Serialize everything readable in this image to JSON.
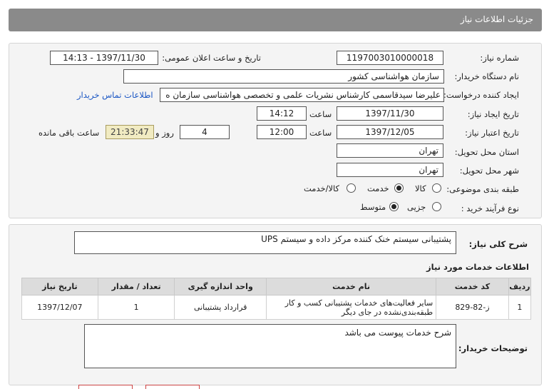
{
  "header": {
    "title": "جزئیات اطلاعات نیاز"
  },
  "fields": {
    "need_number_label": "شماره نیاز:",
    "need_number": "1197003010000018",
    "announce_label": "تاریخ و ساعت اعلان عمومی:",
    "announce_value": "1397/11/30 - 14:13",
    "buyer_label": "نام دستگاه خریدار:",
    "buyer_value": "سازمان هواشناسی کشور",
    "requester_label": "ایجاد کننده درخواست:",
    "requester_value": "علیرضا سیدقاسمی کارشناس نشریات علمی و تخصصی هواشناسی سازمان ه",
    "contact_link": "اطلاعات تماس خریدار",
    "created_label": "تاریخ ایجاد نیاز:",
    "created_date": "1397/11/30",
    "time_label": "ساعت",
    "created_time": "14:12",
    "validity_label": "تاریخ اعتبار نیاز:",
    "validity_date": "1397/12/05",
    "validity_time": "12:00",
    "days_value": "4",
    "days_label": "روز و",
    "remaining_value": "21:33:47",
    "remaining_label": "ساعت باقی مانده",
    "province_label": "استان محل تحویل:",
    "province_value": "تهران",
    "city_label": "شهر محل تحویل:",
    "city_value": "تهران",
    "category_label": "طبقه بندی موضوعی:",
    "category_options": [
      "کالا",
      "خدمت",
      "کالا/خدمت"
    ],
    "category_selected": "خدمت",
    "process_label": "نوع فرآیند خرید :",
    "process_options": [
      "جزیی",
      "متوسط"
    ],
    "process_selected": "متوسط"
  },
  "summary": {
    "label": "شرح کلی نیاز:",
    "value": "پشتیبانی سیستم خنک کننده مرکز داده و سیستم UPS"
  },
  "services": {
    "section_title": "اطلاعات خدمات مورد نیاز",
    "columns": [
      "ردیف",
      "کد خدمت",
      "نام خدمت",
      "واحد اندازه گیری",
      "تعداد / مقدار",
      "تاریخ نیاز"
    ],
    "rows": [
      {
        "row": "1",
        "code": "ز-82-829",
        "name": "سایر فعالیت‌های خدمات پشتیبانی کسب و کار طبقه‌بندی‌نشده در جای دیگر",
        "unit": "قرارداد پشتیبانی",
        "qty": "1",
        "date": "1397/12/07"
      }
    ]
  },
  "buyer_notes": {
    "label": "توضیحات خریدار:",
    "value": "شرح خدمات پیوست می باشد"
  }
}
